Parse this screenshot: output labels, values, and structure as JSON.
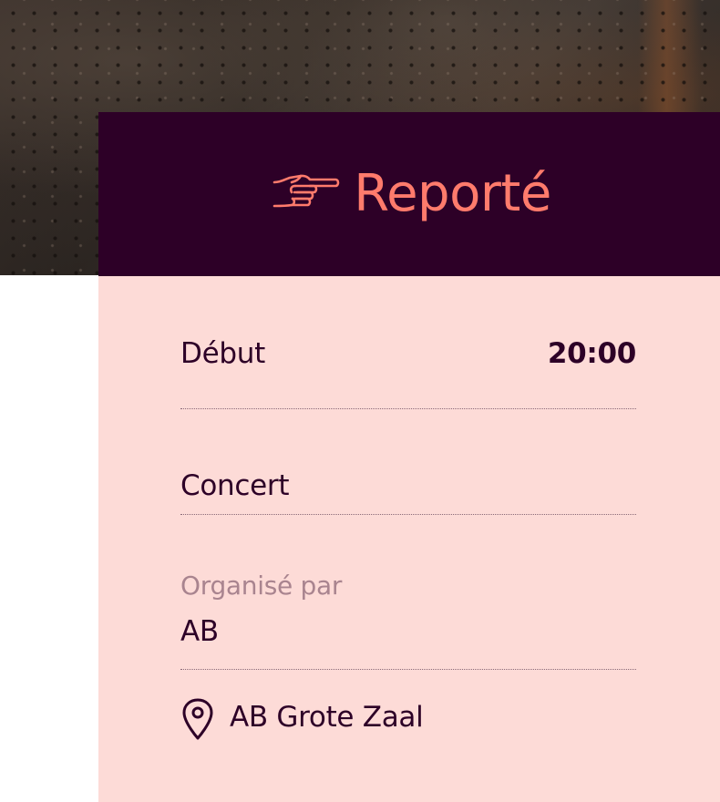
{
  "status": {
    "icon": "pointing-hand-icon",
    "label": "Reporté",
    "banner_color": "#2d0027",
    "label_color": "#ff7b6c"
  },
  "details": {
    "start": {
      "label": "Début",
      "value": "20:00"
    },
    "type": {
      "label": "Concert"
    },
    "organizer": {
      "label": "Organisé par",
      "value": "AB"
    },
    "location": {
      "icon": "map-pin-icon",
      "value": "AB Grote Zaal"
    }
  },
  "colors": {
    "card_background": "#fddbd7",
    "text_primary": "#2d0027",
    "text_muted": "#a9848f"
  }
}
